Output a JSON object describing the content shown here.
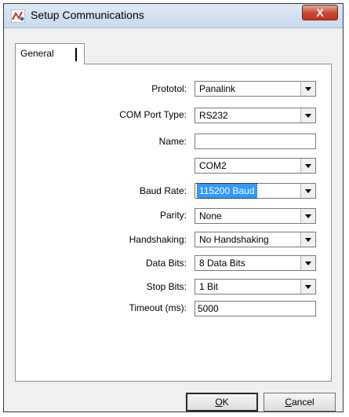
{
  "window": {
    "title": "Setup Communications",
    "close_label": "X"
  },
  "tabs": [
    {
      "label": "General"
    }
  ],
  "form": {
    "protocol": {
      "label": "Prototol:",
      "value": "Panalink"
    },
    "com_port_type": {
      "label": "COM Port Type:",
      "value": "RS232"
    },
    "name": {
      "label": "Name:",
      "value": ""
    },
    "com_port": {
      "value": "COM2"
    },
    "baud_rate": {
      "label": "Baud Rate:",
      "value": "115200 Baud"
    },
    "parity": {
      "label": "Parity:",
      "value": "None"
    },
    "handshaking": {
      "label": "Handshaking:",
      "value": "No Handshaking"
    },
    "data_bits": {
      "label": "Data Bits:",
      "value": "8 Data Bits"
    },
    "stop_bits": {
      "label": "Stop Bits:",
      "value": "1 Bit"
    },
    "timeout": {
      "label": "Timeout (ms):",
      "value": "5000"
    }
  },
  "buttons": {
    "ok": {
      "mnemonic": "O",
      "rest": "K"
    },
    "cancel": {
      "mnemonic": "C",
      "rest": "ancel"
    }
  }
}
